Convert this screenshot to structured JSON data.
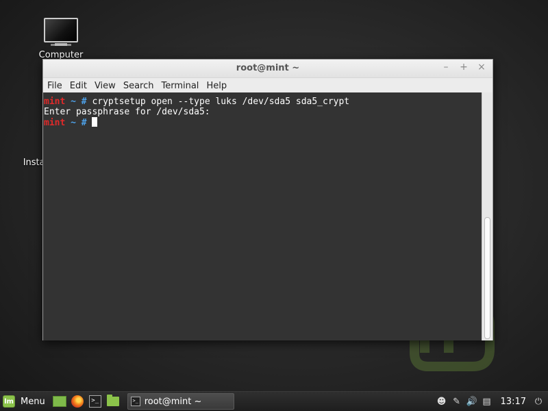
{
  "desktop": {
    "icons": [
      {
        "label": "Computer",
        "icon": "computer-icon"
      },
      {
        "label": "Install Linux Mint",
        "icon": "disc-icon"
      }
    ]
  },
  "terminal": {
    "title": "root@mint ~",
    "controls": {
      "minimize": "–",
      "maximize": "+",
      "close": "×"
    },
    "menu": [
      "File",
      "Edit",
      "View",
      "Search",
      "Terminal",
      "Help"
    ],
    "lines": {
      "l1": {
        "host": "mint",
        "dir": "~",
        "sym": "#",
        "cmd": "cryptsetup open --type luks /dev/sda5 sda5_crypt"
      },
      "l2": {
        "text": "Enter passphrase for /dev/sda5:"
      },
      "l3": {
        "host": "mint",
        "dir": "~",
        "sym": "#"
      }
    },
    "colors": {
      "background": "#333333",
      "prompt_host": "#e02a2a",
      "prompt_dir": "#4ea2ea",
      "text": "#ffffff"
    }
  },
  "panel": {
    "menu_label": "Menu",
    "launchers": [
      "show-desktop-icon",
      "firefox-icon",
      "terminal-icon",
      "files-icon"
    ],
    "task": "root@mint ~",
    "tray": [
      "user-icon",
      "pen-icon",
      "volume-icon",
      "clipboard-icon",
      "power-icon"
    ],
    "clock": "13:17"
  }
}
